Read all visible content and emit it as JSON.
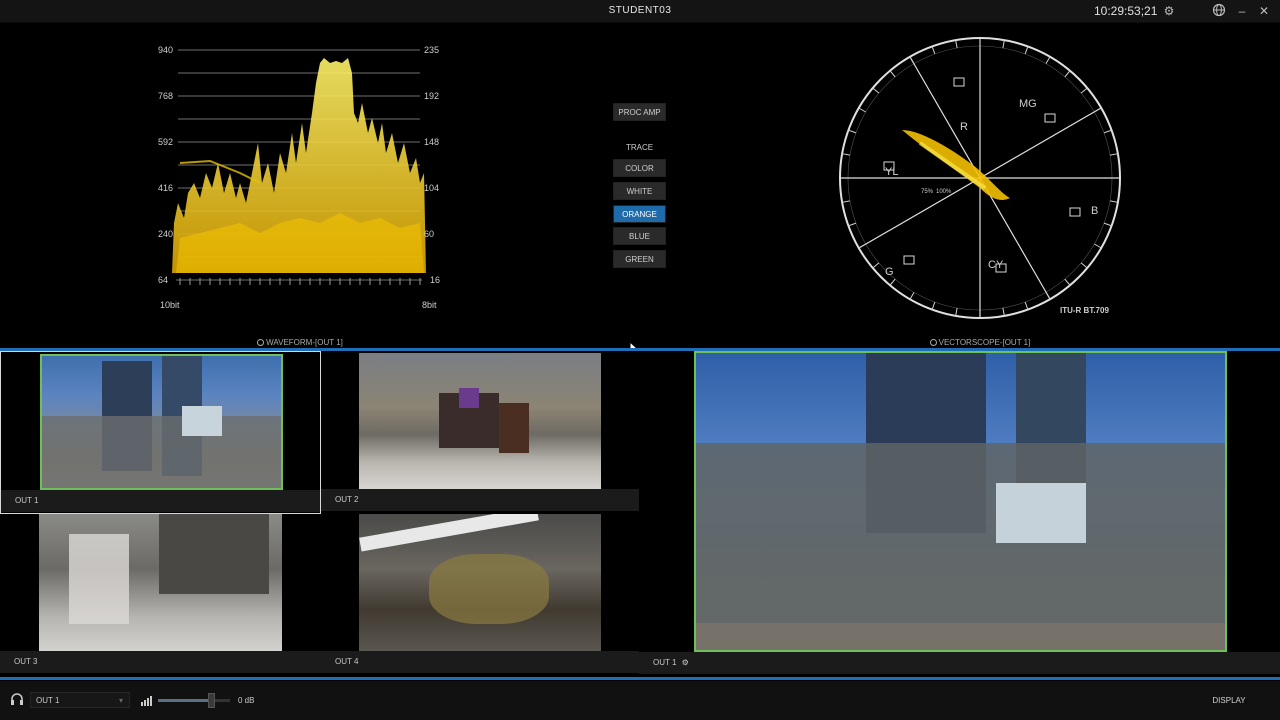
{
  "window": {
    "title": "STUDENT03",
    "clock": "10:29:53;21",
    "icons": [
      "gear-icon",
      "globe-icon",
      "minimize-icon",
      "close-icon"
    ]
  },
  "waveform": {
    "label": "WAVEFORM-[OUT 1]",
    "left_scale": [
      "940",
      "768",
      "592",
      "416",
      "240",
      "64"
    ],
    "right_scale": [
      "235",
      "192",
      "148",
      "104",
      "60",
      "16"
    ],
    "left_unit": "10bit",
    "right_unit": "8bit"
  },
  "controls": {
    "proc_amp": "PROC AMP",
    "trace_heading": "TRACE",
    "trace_options": [
      "COLOR",
      "WHITE",
      "ORANGE",
      "BLUE",
      "GREEN"
    ],
    "selected_trace": "ORANGE",
    "accent_color": "#1f6aa8"
  },
  "vectorscope": {
    "label": "VECTORSCOPE-[OUT 1]",
    "standard": "ITU-R BT.709",
    "targets": [
      "R",
      "MG",
      "B",
      "CY",
      "G",
      "YL"
    ],
    "percent_labels": [
      "75%",
      "100%"
    ]
  },
  "outputs": {
    "out1": "OUT 1",
    "out2": "OUT 2",
    "out3": "OUT 3",
    "out4": "OUT 4",
    "program": "OUT 1"
  },
  "bottom": {
    "headphone_source": "OUT 1",
    "volume_label": "0 dB",
    "volume_level": 0.75,
    "display_button": "DISPLAY"
  }
}
